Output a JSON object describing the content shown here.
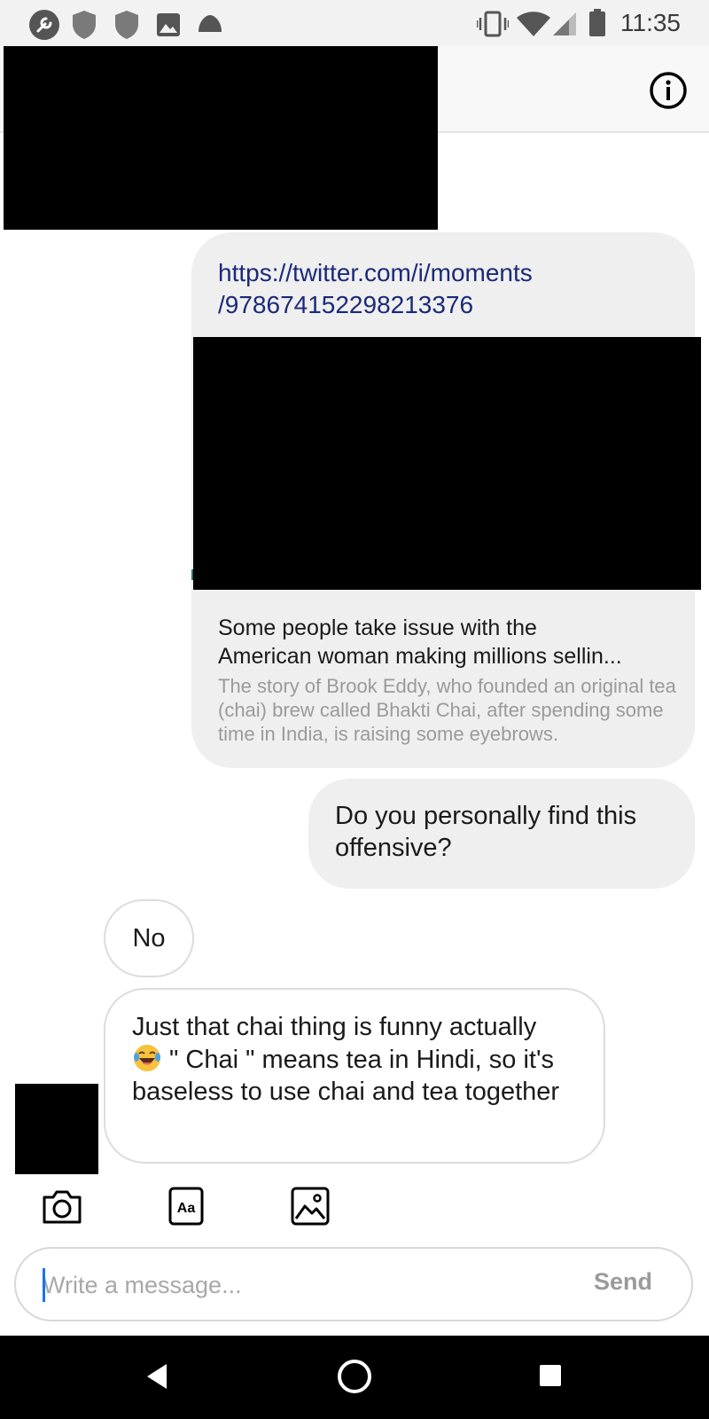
{
  "status_bar": {
    "time": "11:35",
    "left_icons": [
      "wrench-icon",
      "shield-icon",
      "shield-icon",
      "image-icon",
      "cloud-icon"
    ],
    "right_icons": [
      "vibrate-icon",
      "wifi-icon",
      "signal-icon",
      "battery-icon"
    ]
  },
  "header": {
    "info_icon": "info-icon"
  },
  "messages": {
    "link_card": {
      "url": "https://twitter.com/i/moments/978674152298213376",
      "url_line1": "https://twitter.com/i/moments",
      "url_line2": "/978674152298213376",
      "title_line1": "Some people take issue with the",
      "title_line2": "American woman making millions sellin...",
      "description": "The story of Brook Eddy, who founded an original tea (chai) brew called Bhakti Chai, after spending some time in India, is raising some eyebrows."
    },
    "outgoing_question": "Do you personally find this offensive?",
    "incoming_no": "No",
    "incoming_long_part1": "Just that chai thing is funny actually",
    "incoming_long_emoji": "face-with-tears-of-joy",
    "incoming_long_part2": " \" Chai \" means tea in Hindi,  so it's baseless to use chai and tea together"
  },
  "toolbar": {
    "icons": [
      "camera-icon",
      "text-format-icon",
      "gallery-icon"
    ],
    "text_format_label": "Aa"
  },
  "composer": {
    "placeholder": "Write a message...",
    "value": "",
    "send_label": "Send"
  },
  "nav_bar": {
    "icons": [
      "back-icon",
      "home-icon",
      "recents-icon"
    ]
  },
  "colors": {
    "link_text": "#1b2a78",
    "bubble_grey": "#efefef",
    "cursor_blue": "#1a73e8",
    "redaction": "#000000"
  }
}
